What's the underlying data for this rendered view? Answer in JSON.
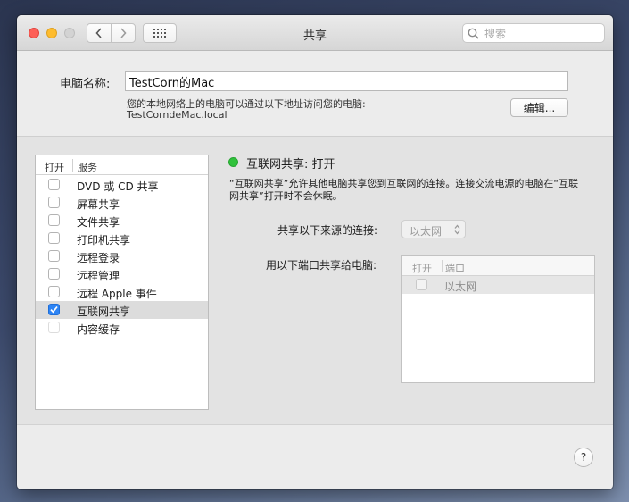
{
  "window": {
    "title": "共享"
  },
  "search": {
    "placeholder": "搜索"
  },
  "computer_name": {
    "label": "电脑名称:",
    "value": "TestCorn的Mac",
    "address_note": "您的本地网络上的电脑可以通过以下地址访问您的电脑:",
    "address": "TestCorndeMac.local",
    "edit_label": "编辑..."
  },
  "services": {
    "header_open": "打开",
    "header_service": "服务",
    "items": [
      {
        "label": "DVD 或 CD 共享",
        "checked": false
      },
      {
        "label": "屏幕共享",
        "checked": false
      },
      {
        "label": "文件共享",
        "checked": false
      },
      {
        "label": "打印机共享",
        "checked": false
      },
      {
        "label": "远程登录",
        "checked": false
      },
      {
        "label": "远程管理",
        "checked": false
      },
      {
        "label": "远程 Apple 事件",
        "checked": false
      },
      {
        "label": "互联网共享",
        "checked": true,
        "selected": true
      },
      {
        "label": "内容缓存",
        "checked": false
      }
    ]
  },
  "detail": {
    "status": "互联网共享: 打开",
    "status_color": "#31c23c",
    "description_line1": "“互联网共享”允许其他电脑共享您到互联网的连接。连接交流电源的电脑在“互联",
    "description_line2": "网共享”打开时不会休眠。",
    "source_label": "共享以下来源的连接:",
    "source_value": "以太网",
    "ports_label": "用以下端口共享给电脑:",
    "ports_header_open": "打开",
    "ports_header_port": "端口",
    "ports": [
      {
        "label": "以太网",
        "checked": false
      }
    ]
  },
  "help_label": "?"
}
